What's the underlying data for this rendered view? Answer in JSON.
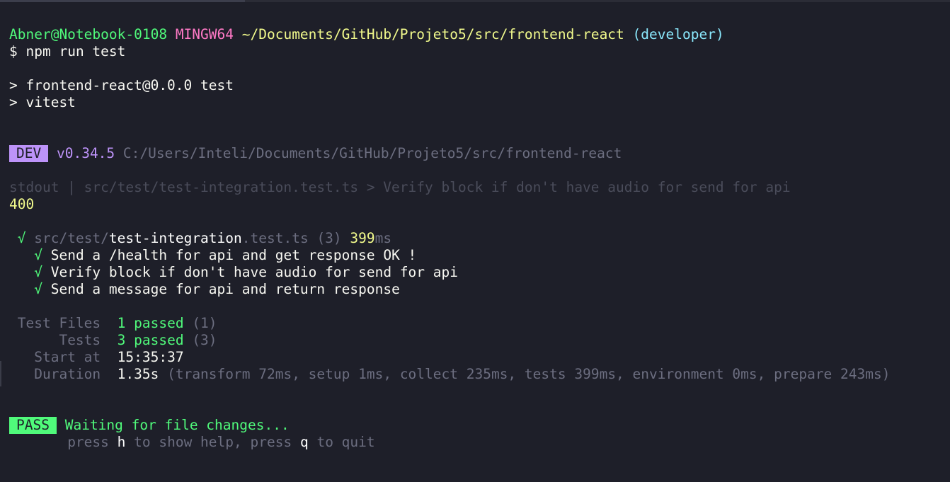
{
  "prompt": {
    "user_host": "Abner@Notebook-0108",
    "system": "MINGW64",
    "path": "~/Documents/GitHub/Projeto5/src/frontend-react",
    "branch": "(developer)",
    "symbol": "$",
    "command": "npm run test"
  },
  "npm_script": {
    "line1": "> frontend-react@0.0.0 test",
    "line2": "> vitest"
  },
  "vitest_header": {
    "mode_badge": "DEV",
    "version": "v0.34.5",
    "root": "C:/Users/Inteli/Documents/GitHub/Projeto5/src/frontend-react"
  },
  "stdout": {
    "label": "stdout | src/test/test-integration.test.ts > Verify block if don't have audio for send for api",
    "value": "400"
  },
  "test_file": {
    "check": "√",
    "dir": "src/test/",
    "name": "test-integration",
    "ext": ".test.ts",
    "count": "(3)",
    "time_value": "399",
    "time_unit": "ms"
  },
  "tests": [
    {
      "check": "√",
      "name": "Send a /health for api and get response OK !"
    },
    {
      "check": "√",
      "name": "Verify block if don't have audio for send for api"
    },
    {
      "check": "√",
      "name": "Send a message for api and return response"
    }
  ],
  "summary": {
    "files_label": "Test Files",
    "files_passed": "1 passed",
    "files_total": "(1)",
    "tests_label": "Tests",
    "tests_passed": "3 passed",
    "tests_total": "(3)",
    "start_label": "Start at",
    "start_value": "15:35:37",
    "duration_label": "Duration",
    "duration_value": "1.35s",
    "duration_detail": "(transform 72ms, setup 1ms, collect 235ms, tests 399ms, environment 0ms, prepare 243ms)"
  },
  "status": {
    "badge": "PASS",
    "message": "Waiting for file changes...",
    "help_press1": "press",
    "help_key_h": "h",
    "help_mid": "to show help, press",
    "help_key_q": "q",
    "help_end": "to quit"
  },
  "colors": {
    "background": "#1e1f29",
    "green": "#50fa7b",
    "pink": "#ff79c6",
    "yellow": "#f1fa8c",
    "cyan": "#8be9fd",
    "purple": "#bd93f9"
  }
}
